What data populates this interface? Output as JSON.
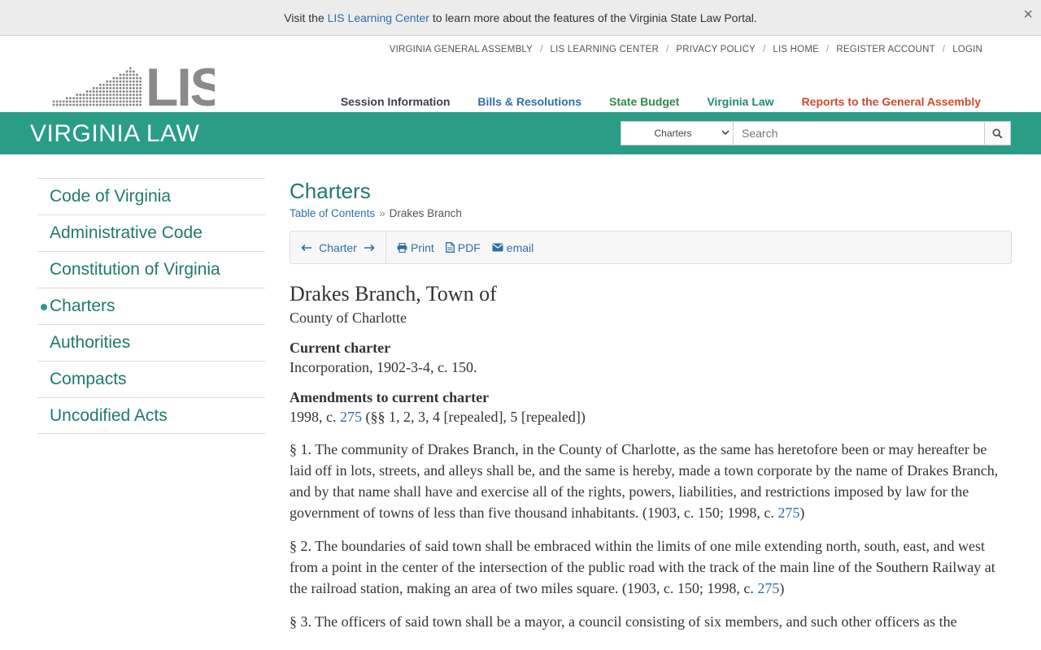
{
  "banner": {
    "prefix": "Visit the ",
    "link": "LIS Learning Center",
    "suffix": " to learn more about the features of the Virginia State Law Portal.",
    "close": "×"
  },
  "header": {
    "logo_text": "LIS",
    "util_links": [
      "VIRGINIA GENERAL ASSEMBLY",
      "LIS LEARNING CENTER",
      "PRIVACY POLICY",
      "LIS HOME",
      "REGISTER ACCOUNT",
      "LOGIN"
    ],
    "util_sep": "/",
    "nav": [
      "Session Information",
      "Bills & Resolutions",
      "State Budget",
      "Virginia Law",
      "Reports to the General Assembly"
    ]
  },
  "band": {
    "title": "VIRGINIA LAW",
    "search_scope": "Charters",
    "search_placeholder": "Search"
  },
  "sidebar": {
    "items": [
      "Code of Virginia",
      "Administrative Code",
      "Constitution of Virginia",
      "Charters",
      "Authorities",
      "Compacts",
      "Uncodified Acts"
    ],
    "active": "Charters"
  },
  "main": {
    "title": "Charters",
    "breadcrumb": {
      "toc": "Table of Contents",
      "sep": "»",
      "current": "Drakes Branch"
    },
    "toolbar": {
      "nav_label": "Charter",
      "print": "Print",
      "pdf": "PDF",
      "email": "email"
    }
  },
  "doc": {
    "title": "Drakes Branch, Town of",
    "county": "County of Charlotte",
    "current_heading": "Current charter",
    "current_text": "Incorporation, 1902-3-4, c. 150.",
    "amend_heading": "Amendments to current charter",
    "amend_prefix": "1998, c. ",
    "amend_link": "275",
    "amend_suffix": " (§§ 1, 2, 3, 4 [repealed], 5 [repealed])",
    "s1_text": "§ 1. The community of Drakes Branch, in the County of Charlotte, as the same has heretofore been or may hereafter be laid off in lots, streets, and alleys shall be, and the same is hereby, made a town corporate by the name of Drakes Branch, and by that name shall have and exercise all of the rights, powers, liabilities, and restrictions imposed by law for the government of towns of less than five thousand inhabitants.  (1903, c. 150; 1998, c. ",
    "s1_link": "275",
    "s1_close": ")",
    "s2_text": "§ 2. The boundaries of said town shall be embraced within the limits of one mile extending north, south, east, and west from a point in the center of the intersection of the public road with the track of the main line of the Southern Railway at the railroad station, making an area of two miles square.  (1903, c. 150; 1998, c. ",
    "s2_link": "275",
    "s2_close": ")",
    "s3_text": "§ 3. The officers of said town shall be a mayor, a council consisting of six members, and such other officers as the"
  }
}
